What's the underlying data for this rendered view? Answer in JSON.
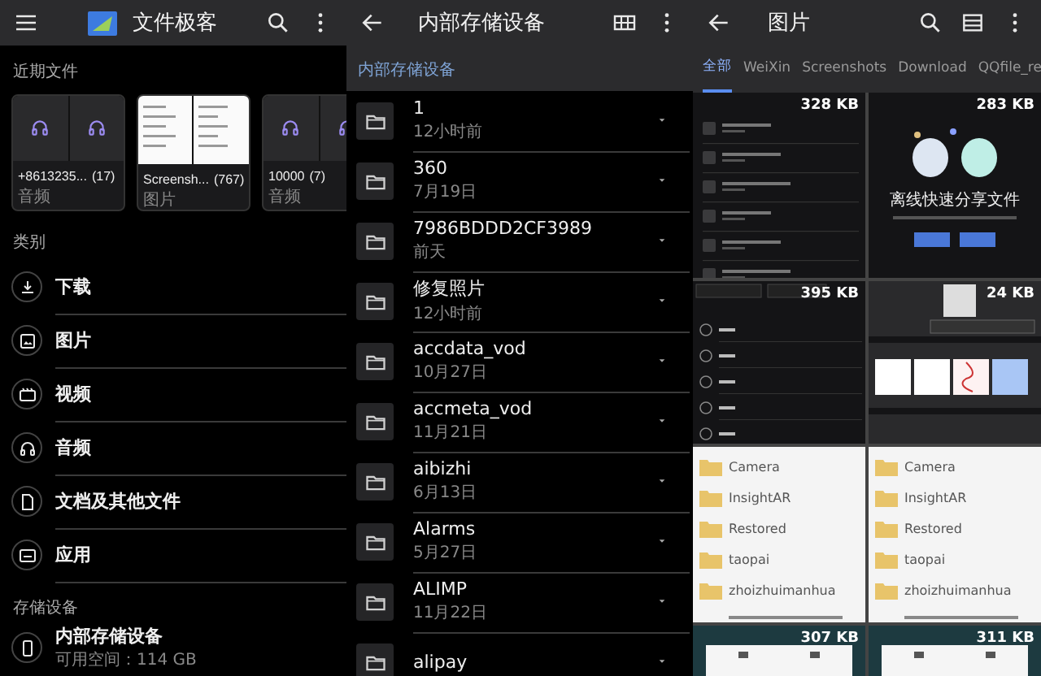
{
  "home": {
    "title": "文件极客",
    "recent_label": "近期文件",
    "recent": [
      {
        "name": "+8613235...",
        "count": "(17)",
        "type": "音频",
        "kind": "audio"
      },
      {
        "name": "Screensh...",
        "count": "(767)",
        "type": "图片",
        "kind": "image"
      },
      {
        "name": "10000",
        "count": "(7)",
        "type": "音频",
        "kind": "audio"
      }
    ],
    "categories_label": "类别",
    "categories": [
      {
        "label": "下载",
        "kind": "download"
      },
      {
        "label": "图片",
        "kind": "image"
      },
      {
        "label": "视频",
        "kind": "video"
      },
      {
        "label": "音频",
        "kind": "audio"
      },
      {
        "label": "文档及其他文件",
        "kind": "document"
      },
      {
        "label": "应用",
        "kind": "app"
      }
    ],
    "storage_label": "存储设备",
    "storage": {
      "name": "内部存储设备",
      "free": "可用空间：114 GB"
    }
  },
  "storage": {
    "title": "内部存储设备",
    "breadcrumb": "内部存储设备",
    "folders": [
      {
        "name": "1",
        "date": "12小时前"
      },
      {
        "name": "360",
        "date": "7月19日"
      },
      {
        "name": "7986BDDD2CF3989",
        "date": "前天"
      },
      {
        "name": "修复照片",
        "date": "12小时前"
      },
      {
        "name": "accdata_vod",
        "date": "10月27日"
      },
      {
        "name": "accmeta_vod",
        "date": "11月21日"
      },
      {
        "name": "aibizhi",
        "date": "6月13日"
      },
      {
        "name": "Alarms",
        "date": "5月27日"
      },
      {
        "name": "ALIMP",
        "date": "11月22日"
      },
      {
        "name": "alipay"
      }
    ]
  },
  "images": {
    "title": "图片",
    "tabs": [
      {
        "label": "全部",
        "selected": true
      },
      {
        "label": "WeiXin",
        "selected": false
      },
      {
        "label": "Screenshots",
        "selected": false
      },
      {
        "label": "Download",
        "selected": false
      },
      {
        "label": "QQfile_re",
        "selected": false
      }
    ],
    "thumbnails": [
      {
        "kind": "folder-list",
        "size": "328 KB"
      },
      {
        "kind": "share",
        "size": "283 KB",
        "caption": "离线快速分享文件"
      },
      {
        "kind": "menu",
        "size": "395 KB"
      },
      {
        "kind": "cards",
        "size": "24 KB"
      },
      {
        "kind": "folders",
        "folders": [
          "Camera",
          "InsightAR",
          "Restored",
          "taopai",
          "zhoizhuimanhua"
        ]
      },
      {
        "kind": "folders",
        "folders": [
          "Camera",
          "InsightAR",
          "Restored",
          "taopai",
          "zhoizhuimanhua"
        ]
      },
      {
        "kind": "device",
        "size": "307 KB"
      },
      {
        "kind": "device",
        "size": "311 KB"
      }
    ]
  }
}
